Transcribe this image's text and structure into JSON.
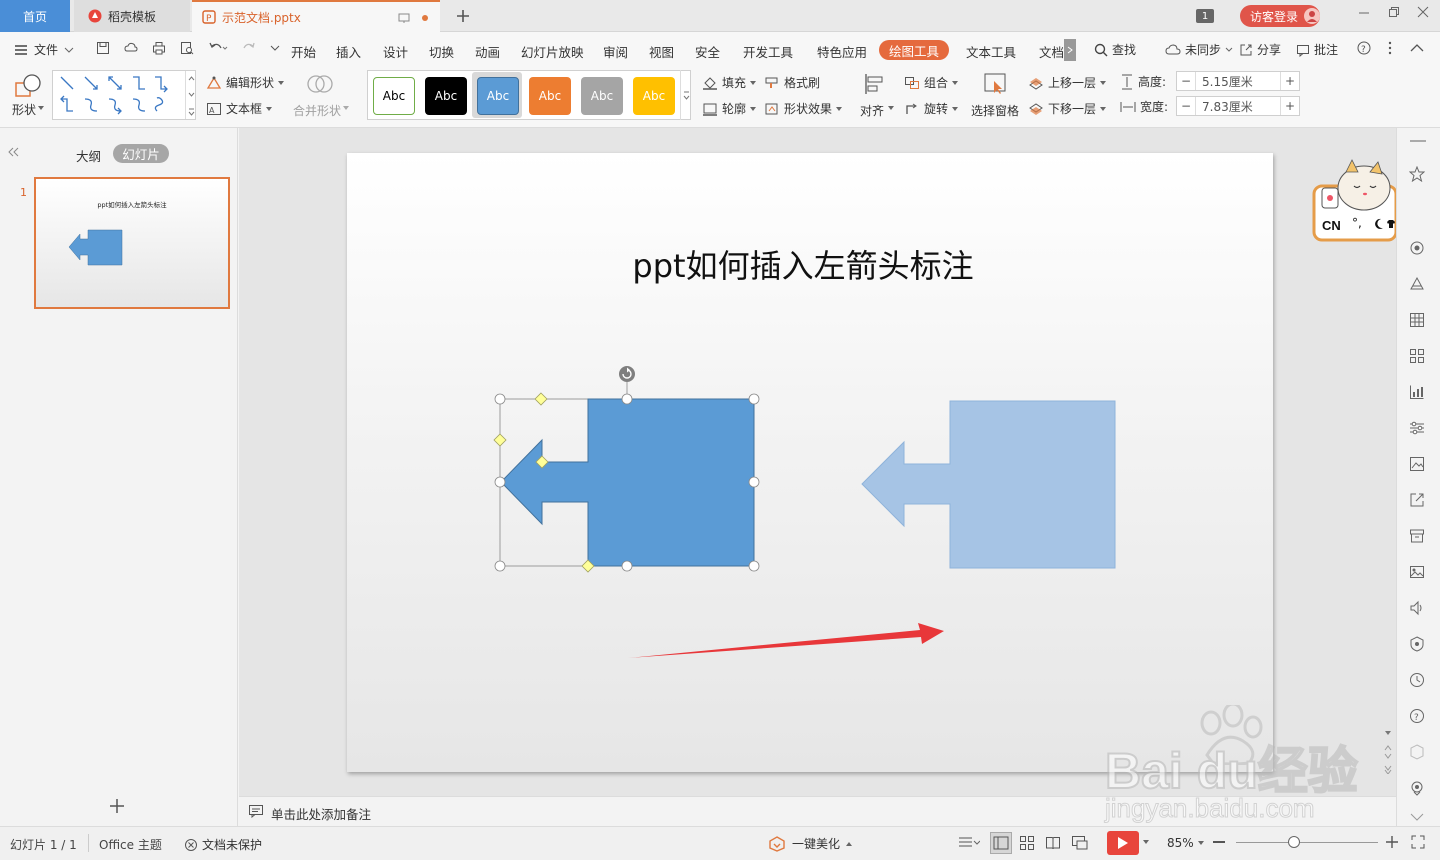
{
  "tabs": {
    "home": "首页",
    "template": "稻壳模板",
    "document": "示范文档.pptx",
    "badge": "1",
    "login": "访客登录"
  },
  "menu": {
    "file": "文件",
    "items": [
      "开始",
      "插入",
      "设计",
      "切换",
      "动画",
      "幻灯片放映",
      "审阅",
      "视图",
      "安全",
      "开发工具",
      "特色应用"
    ],
    "active": "绘图工具",
    "text_tools": "文本工具",
    "doc": "文档",
    "search": "查找",
    "sync": "未同步",
    "share": "分享",
    "comment": "批注"
  },
  "ribbon": {
    "shape": "形状",
    "edit_shape": "编辑形状",
    "textbox": "文本框",
    "merge_shape": "合并形状",
    "style_label": "Abc",
    "fill": "填充",
    "format_painter": "格式刷",
    "outline": "轮廓",
    "shape_effect": "形状效果",
    "align": "对齐",
    "group": "组合",
    "rotate": "旋转",
    "select_pane": "选择窗格",
    "bring_forward": "上移一层",
    "send_backward": "下移一层",
    "height_label": "高度:",
    "height_value": "5.15厘米",
    "width_label": "宽度:",
    "width_value": "7.83厘米"
  },
  "colors": {
    "accent": "#e56a3d",
    "shape_fill": "#5b9bd5",
    "shape_fill_faded": "#a6c4e5",
    "arrow": "#e8373a",
    "style_white": "#ffffff",
    "style_black": "#000000",
    "style_blue": "#5b9bd5",
    "style_orange": "#ed7d31",
    "style_gray": "#a5a5a5",
    "style_gold": "#ffc000"
  },
  "panel": {
    "outline_tab": "大纲",
    "slides_tab": "幻灯片",
    "slide_number": "1",
    "thumb_title": "ppt如何插入左箭头标注"
  },
  "slide": {
    "title": "ppt如何插入左箭头标注"
  },
  "ime": {
    "text": "CN"
  },
  "notes": {
    "placeholder": "单击此处添加备注"
  },
  "status": {
    "slide_counter": "幻灯片 1 / 1",
    "theme": "Office 主题",
    "protection": "文档未保护",
    "beautify": "一键美化",
    "zoom": "85%"
  },
  "watermark": {
    "brand": "Bai du经验",
    "url": "jingyan.baidu.com"
  }
}
